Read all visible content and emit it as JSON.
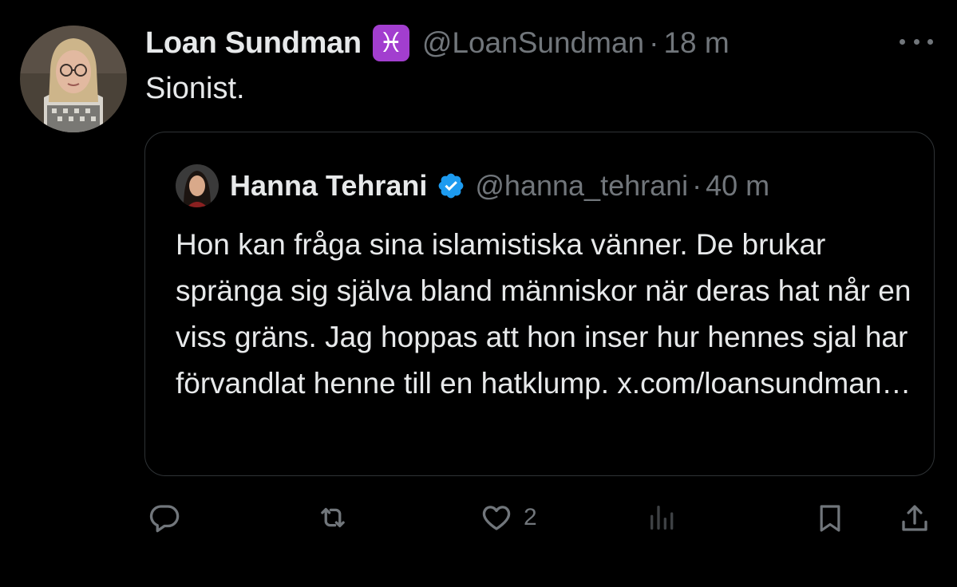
{
  "tweet": {
    "author": {
      "name": "Loan Sundman",
      "badge": "♓",
      "handle": "@LoanSundman",
      "separator": "·",
      "time": "18 m"
    },
    "text": "Sionist.",
    "quote": {
      "author": {
        "name": "Hanna Tehrani",
        "handle": "@hanna_tehrani",
        "separator": "·",
        "time": "40 m"
      },
      "text": "Hon kan fråga sina islamistiska vänner. De brukar spränga sig själva bland människor när deras hat når en viss gräns. Jag hoppas att hon inser hur hennes sjal har förvandlat henne till en hatklump. x.com/loansundman…"
    },
    "actions": {
      "likes": "2"
    }
  },
  "colors": {
    "background": "#000000",
    "text": "#e7e9ea",
    "secondary": "#71767b",
    "border": "#2f3336",
    "verified": "#1d9bf0",
    "zodiac_badge": "#a23ecf"
  },
  "icons": [
    "more-icon",
    "zodiac-pisces-icon",
    "verified-badge-icon",
    "reply-icon",
    "retweet-icon",
    "like-icon",
    "views-icon",
    "bookmark-icon",
    "share-icon"
  ]
}
